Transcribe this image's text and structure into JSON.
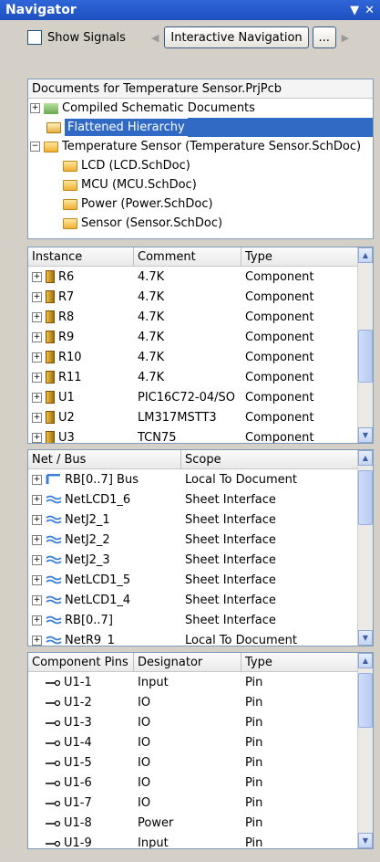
{
  "window": {
    "title": "Navigator",
    "menu_glyph": "▼",
    "close_glyph": "✕"
  },
  "toolbar": {
    "show_signals": "Show Signals",
    "interactive_navigation": "Interactive Navigation",
    "more": "...",
    "back_glyph": "◀",
    "fwd_glyph": "▶"
  },
  "documents": {
    "header": "Documents for Temperature Sensor.PrjPcb",
    "items": [
      {
        "label": "Compiled  Schematic Documents"
      },
      {
        "label": "Flattened Hierarchy"
      },
      {
        "label": "Temperature Sensor (Temperature Sensor.SchDoc)"
      },
      {
        "label": "LCD (LCD.SchDoc)"
      },
      {
        "label": "MCU (MCU.SchDoc)"
      },
      {
        "label": "Power (Power.SchDoc)"
      },
      {
        "label": "Sensor (Sensor.SchDoc)"
      }
    ]
  },
  "instances": {
    "columns": [
      "Instance",
      "Comment",
      "Type"
    ],
    "rows": [
      [
        "R6",
        "4.7K",
        "Component"
      ],
      [
        "R7",
        "4.7K",
        "Component"
      ],
      [
        "R8",
        "4.7K",
        "Component"
      ],
      [
        "R9",
        "4.7K",
        "Component"
      ],
      [
        "R10",
        "4.7K",
        "Component"
      ],
      [
        "R11",
        "4.7K",
        "Component"
      ],
      [
        "U1",
        "PIC16C72-04/SO",
        "Component"
      ],
      [
        "U2",
        "LM317MSTT3",
        "Component"
      ],
      [
        "U3",
        "TCN75",
        "Component"
      ]
    ]
  },
  "nets": {
    "columns": [
      "Net / Bus",
      "Scope"
    ],
    "rows": [
      [
        "RB[0..7] Bus",
        "Local To Document"
      ],
      [
        "NetLCD1_6",
        "Sheet Interface"
      ],
      [
        "NetJ2_1",
        "Sheet Interface"
      ],
      [
        "NetJ2_2",
        "Sheet Interface"
      ],
      [
        "NetJ2_3",
        "Sheet Interface"
      ],
      [
        "NetLCD1_5",
        "Sheet Interface"
      ],
      [
        "NetLCD1_4",
        "Sheet Interface"
      ],
      [
        "RB[0..7]",
        "Sheet Interface"
      ],
      [
        "NetR9_1",
        "Local To Document"
      ]
    ]
  },
  "pins": {
    "columns": [
      "Component Pins",
      "Designator",
      "Type"
    ],
    "rows": [
      [
        "U1-1",
        "Input",
        "Pin"
      ],
      [
        "U1-2",
        "IO",
        "Pin"
      ],
      [
        "U1-3",
        "IO",
        "Pin"
      ],
      [
        "U1-4",
        "IO",
        "Pin"
      ],
      [
        "U1-5",
        "IO",
        "Pin"
      ],
      [
        "U1-6",
        "IO",
        "Pin"
      ],
      [
        "U1-7",
        "IO",
        "Pin"
      ],
      [
        "U1-8",
        "Power",
        "Pin"
      ],
      [
        "U1-9",
        "Input",
        "Pin"
      ]
    ]
  },
  "colors": {
    "title_bar": "#2f66d8",
    "selection": "#316ac5",
    "net_icon": "#3a7fd8"
  }
}
